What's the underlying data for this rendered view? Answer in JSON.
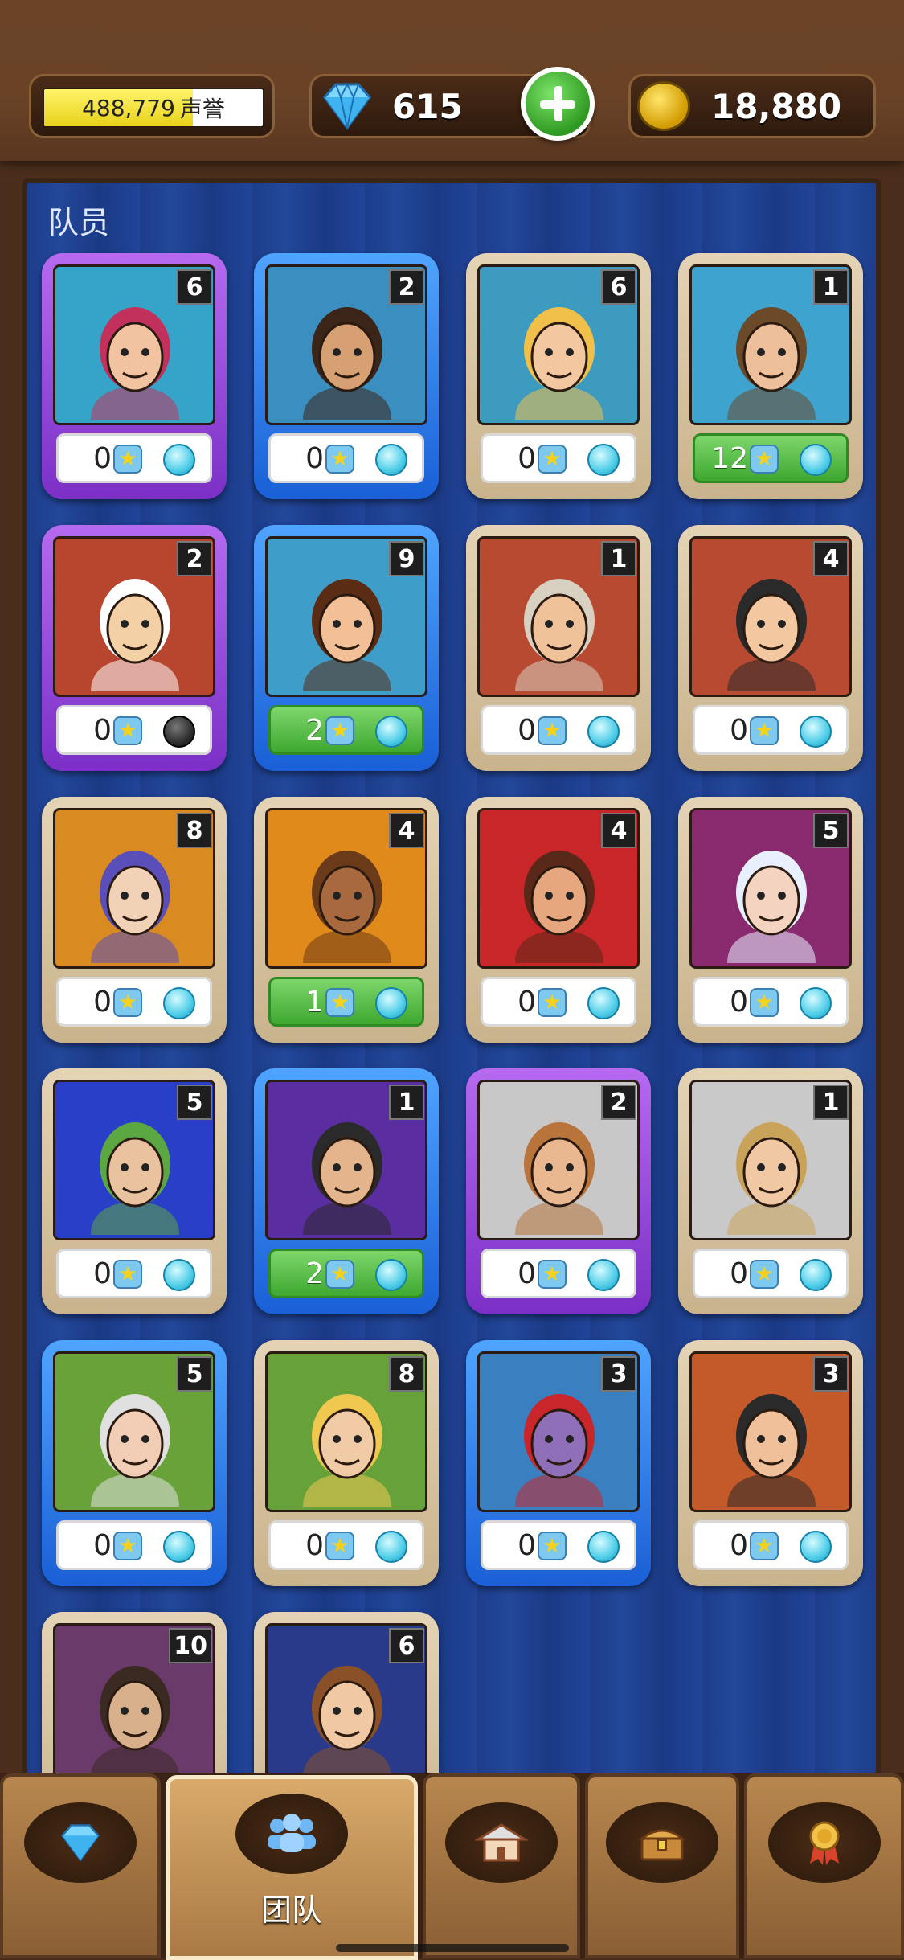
{
  "header": {
    "reputation": {
      "value": "488,779",
      "label": "声誉",
      "fill_fraction": 0.68
    },
    "gems": {
      "value": "615"
    },
    "gold": {
      "value": "18,880"
    }
  },
  "team_panel": {
    "title": "队员",
    "members": [
      {
        "level": "6",
        "stars": "0",
        "rarity": "purple",
        "bg": "#35a4c8",
        "skin": "#f2c3a0",
        "hair": "#c2315c",
        "orb": "light",
        "highlight": false
      },
      {
        "level": "2",
        "stars": "0",
        "rarity": "blue",
        "bg": "#3a8fc0",
        "skin": "#d7a073",
        "hair": "#3b2418",
        "orb": "light",
        "highlight": false
      },
      {
        "level": "6",
        "stars": "0",
        "rarity": "tan",
        "bg": "#3d9bbf",
        "skin": "#f3c8a1",
        "hair": "#f0c04a",
        "orb": "light",
        "highlight": false
      },
      {
        "level": "1",
        "stars": "12",
        "rarity": "tan",
        "bg": "#3fa3cf",
        "skin": "#edc09b",
        "hair": "#6b4a2a",
        "orb": "light",
        "highlight": true
      },
      {
        "level": "2",
        "stars": "0",
        "rarity": "purple",
        "bg": "#b8452e",
        "skin": "#f3d0a6",
        "hair": "#ffffff",
        "orb": "dark",
        "highlight": false
      },
      {
        "level": "9",
        "stars": "2",
        "rarity": "blue",
        "bg": "#3f9ec9",
        "skin": "#f2bf96",
        "hair": "#5a2c14",
        "orb": "light",
        "highlight": true
      },
      {
        "level": "1",
        "stars": "0",
        "rarity": "tan",
        "bg": "#b84a32",
        "skin": "#efc299",
        "hair": "#d8d0c0",
        "orb": "light",
        "highlight": false
      },
      {
        "level": "4",
        "stars": "0",
        "rarity": "tan",
        "bg": "#b84a32",
        "skin": "#f3c8a0",
        "hair": "#2a2a2a",
        "orb": "light",
        "highlight": false
      },
      {
        "level": "8",
        "stars": "0",
        "rarity": "tan",
        "bg": "#d98a20",
        "skin": "#f2d2b6",
        "hair": "#5a4fb8",
        "orb": "light",
        "highlight": false
      },
      {
        "level": "4",
        "stars": "1",
        "rarity": "tan",
        "bg": "#e08a1c",
        "skin": "#a8693f",
        "hair": "#6b3a18",
        "orb": "light",
        "highlight": true
      },
      {
        "level": "4",
        "stars": "0",
        "rarity": "tan",
        "bg": "#c9262a",
        "skin": "#e6a77f",
        "hair": "#5a2818",
        "orb": "light",
        "highlight": false
      },
      {
        "level": "5",
        "stars": "0",
        "rarity": "tan",
        "bg": "#8a2a6e",
        "skin": "#f4d4c0",
        "hair": "#e8f0ff",
        "orb": "light",
        "highlight": false
      },
      {
        "level": "5",
        "stars": "0",
        "rarity": "tan",
        "bg": "#2a3fc8",
        "skin": "#e9c2a0",
        "hair": "#5ba842",
        "orb": "light",
        "highlight": false
      },
      {
        "level": "1",
        "stars": "2",
        "rarity": "blue",
        "bg": "#5a2ea0",
        "skin": "#e4b48c",
        "hair": "#2a2a2a",
        "orb": "light",
        "highlight": true
      },
      {
        "level": "2",
        "stars": "0",
        "rarity": "purple",
        "bg": "#c8c8c8",
        "skin": "#eab890",
        "hair": "#b8743a",
        "orb": "light",
        "highlight": false
      },
      {
        "level": "1",
        "stars": "0",
        "rarity": "tan",
        "bg": "#c9c9c9",
        "skin": "#f0c8a4",
        "hair": "#caa35a",
        "orb": "light",
        "highlight": false
      },
      {
        "level": "5",
        "stars": "0",
        "rarity": "blue",
        "bg": "#6aa23a",
        "skin": "#f0cdb4",
        "hair": "#e0e0e0",
        "orb": "light",
        "highlight": false
      },
      {
        "level": "8",
        "stars": "0",
        "rarity": "tan",
        "bg": "#66a13a",
        "skin": "#f0cba6",
        "hair": "#f0c850",
        "orb": "light",
        "highlight": false
      },
      {
        "level": "3",
        "stars": "0",
        "rarity": "blue",
        "bg": "#3a7fc0",
        "skin": "#8f6fb8",
        "hair": "#c8262a",
        "orb": "light",
        "highlight": false
      },
      {
        "level": "3",
        "stars": "0",
        "rarity": "tan",
        "bg": "#c45a2a",
        "skin": "#efc09a",
        "hair": "#2a2a2a",
        "orb": "light",
        "highlight": false
      },
      {
        "level": "10",
        "stars": "",
        "rarity": "tan",
        "bg": "#6a3a6a",
        "skin": "#d9b08c",
        "hair": "#3a2a22",
        "orb": "light",
        "highlight": false
      },
      {
        "level": "6",
        "stars": "",
        "rarity": "tan",
        "bg": "#2a3a8a",
        "skin": "#f0c8a4",
        "hair": "#8a5028",
        "orb": "light",
        "highlight": false
      }
    ]
  },
  "nav": {
    "tabs": [
      {
        "name": "gems",
        "icon": "gem-icon",
        "label": ""
      },
      {
        "name": "team",
        "icon": "team-icon",
        "label": "团队",
        "active": true
      },
      {
        "name": "town",
        "icon": "building-icon",
        "label": ""
      },
      {
        "name": "chest",
        "icon": "chest-icon",
        "label": ""
      },
      {
        "name": "achievements",
        "icon": "medal-icon",
        "label": ""
      }
    ]
  },
  "colors": {
    "panel_blue": "#1d3d8a",
    "wood": "#6b4428",
    "rarity_purple": "#8a3ed6",
    "rarity_blue": "#2b78e6",
    "rarity_tan": "#d9c6a3",
    "highlight_green": "#56bb44"
  }
}
